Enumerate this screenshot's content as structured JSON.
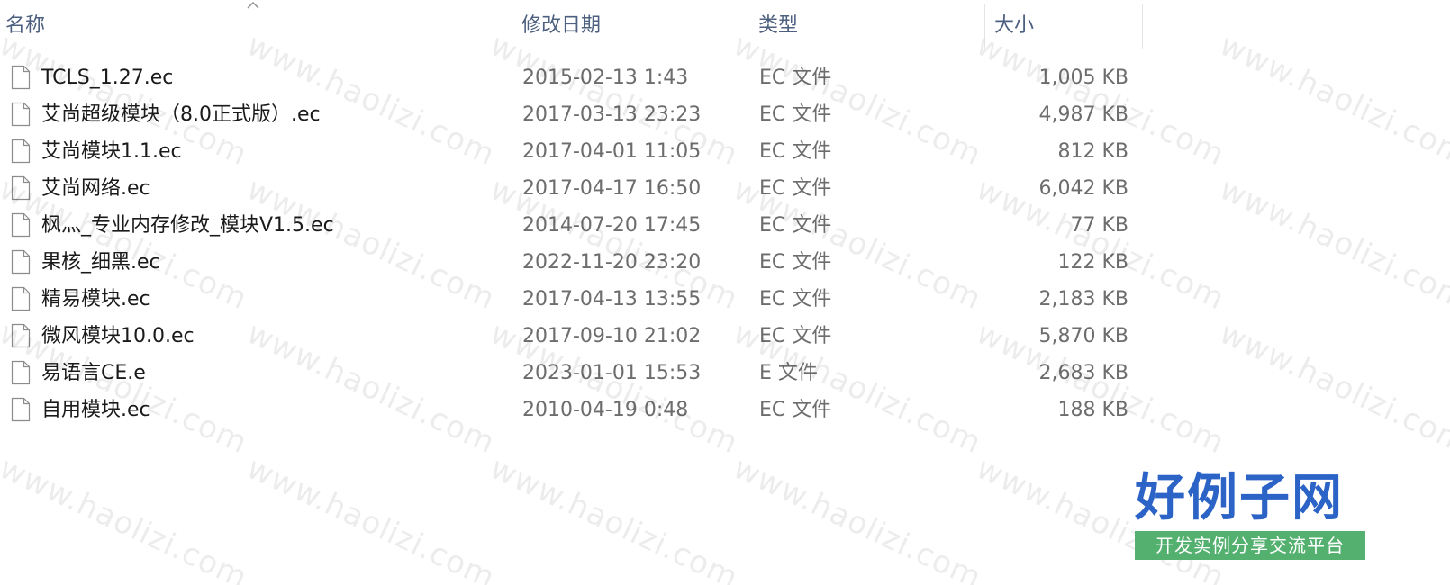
{
  "columns": {
    "name": "名称",
    "date": "修改日期",
    "type": "类型",
    "size": "大小"
  },
  "sort": {
    "column": "name",
    "direction": "ascending"
  },
  "files": [
    {
      "name": "TCLS_1.27.ec",
      "date": "2015-02-13 1:43",
      "type": "EC 文件",
      "size": "1,005 KB"
    },
    {
      "name": "艾尚超级模块（8.0正式版）.ec",
      "date": "2017-03-13 23:23",
      "type": "EC 文件",
      "size": "4,987 KB"
    },
    {
      "name": "艾尚模块1.1.ec",
      "date": "2017-04-01 11:05",
      "type": "EC 文件",
      "size": "812 KB"
    },
    {
      "name": "艾尚网络.ec",
      "date": "2017-04-17 16:50",
      "type": "EC 文件",
      "size": "6,042 KB"
    },
    {
      "name": "枫灬_专业内存修改_模块V1.5.ec",
      "date": "2014-07-20 17:45",
      "type": "EC 文件",
      "size": "77 KB"
    },
    {
      "name": "果核_细黑.ec",
      "date": "2022-11-20 23:20",
      "type": "EC 文件",
      "size": "122 KB"
    },
    {
      "name": "精易模块.ec",
      "date": "2017-04-13 13:55",
      "type": "EC 文件",
      "size": "2,183 KB"
    },
    {
      "name": "微风模块10.0.ec",
      "date": "2017-09-10 21:02",
      "type": "EC 文件",
      "size": "5,870 KB"
    },
    {
      "name": "易语言CE.e",
      "date": "2023-01-01 15:53",
      "type": "E 文件",
      "size": "2,683 KB"
    },
    {
      "name": "自用模块.ec",
      "date": "2010-04-19 0:48",
      "type": "EC 文件",
      "size": "188 KB"
    }
  ],
  "file_icon": "blank-document-icon",
  "watermark": "www.haolizi.com",
  "logo": {
    "title": "好例子网",
    "subtitle": "开发实例分享交流平台",
    "title_color": "#2b63c6",
    "subtitle_bg": "#53b06e"
  }
}
